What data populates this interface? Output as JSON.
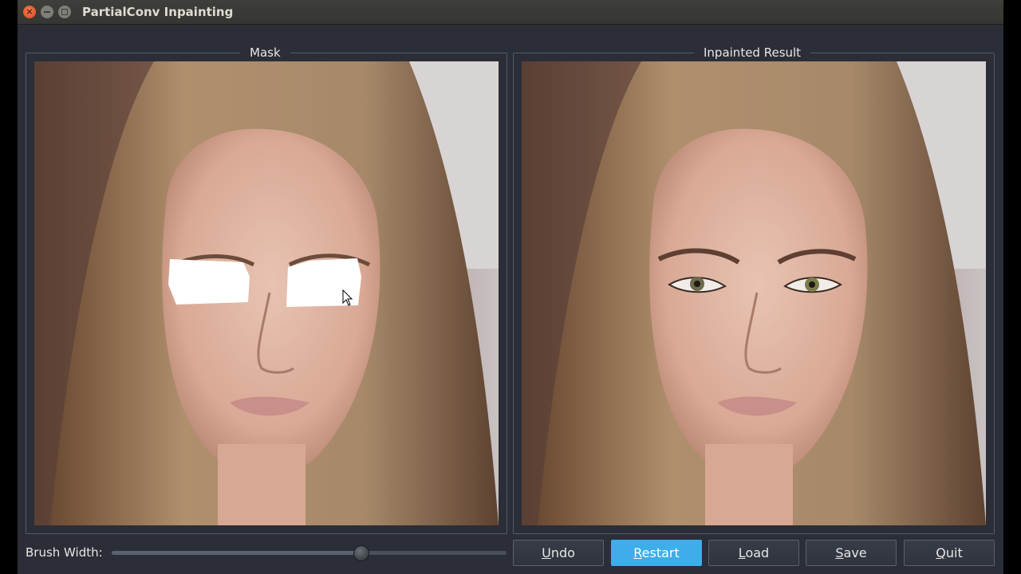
{
  "window": {
    "title": "PartialConv Inpainting"
  },
  "panels": {
    "mask_label": "Mask",
    "result_label": "Inpainted Result"
  },
  "controls": {
    "brush_label": "Brush Width:",
    "brush_value_fraction": 0.63,
    "buttons": [
      {
        "label": "Undo",
        "mnemonic": "U",
        "rest": "ndo"
      },
      {
        "label": "Restart",
        "mnemonic": "R",
        "rest": "estart"
      },
      {
        "label": "Load",
        "mnemonic": "L",
        "rest": "oad"
      },
      {
        "label": "Save",
        "mnemonic": "S",
        "rest": "ave"
      },
      {
        "label": "Quit",
        "mnemonic": "Q",
        "rest": "uit"
      }
    ]
  },
  "colors": {
    "accent": "#3daee9",
    "window_bg": "#2b2e37"
  },
  "icons": {
    "close": "close-icon",
    "minimize": "minimize-icon",
    "maximize": "maximize-icon",
    "pointer": "mouse-pointer-icon"
  }
}
